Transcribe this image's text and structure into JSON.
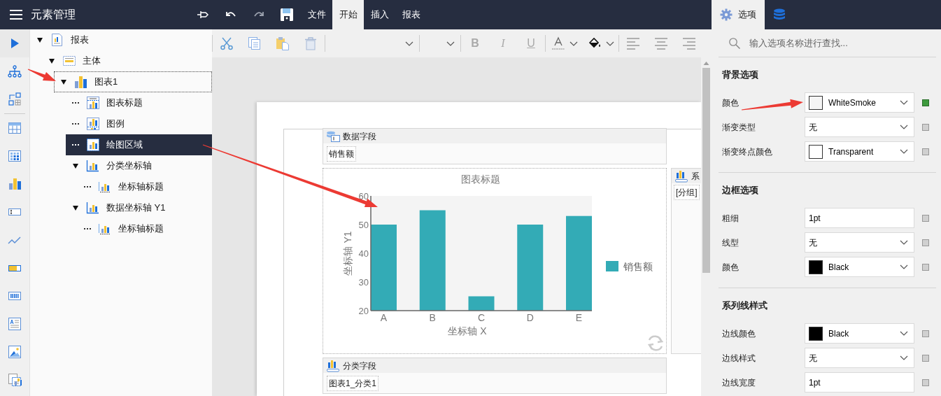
{
  "header": {
    "title": "元素管理",
    "menu": [
      {
        "label": "文件",
        "selected": false
      },
      {
        "label": "开始",
        "selected": true
      },
      {
        "label": "插入",
        "selected": false
      },
      {
        "label": "报表",
        "selected": false
      }
    ]
  },
  "side_tabs": [
    {
      "kind": "options",
      "label": "选项",
      "selected": true
    },
    {
      "kind": "data",
      "selected": false
    }
  ],
  "rail": [
    {
      "kind": "play"
    },
    {
      "kind": "tree"
    },
    {
      "kind": "add"
    },
    {
      "kind": "sep"
    },
    {
      "kind": "table"
    },
    {
      "kind": "matrix"
    },
    {
      "kind": "chart"
    },
    {
      "kind": "textbox"
    },
    {
      "kind": "sparkline"
    },
    {
      "kind": "bar"
    },
    {
      "kind": "barcode"
    },
    {
      "kind": "richtext"
    },
    {
      "kind": "image"
    },
    {
      "kind": "subreport"
    }
  ],
  "tree": [
    {
      "label": "报表",
      "kind": "report",
      "expanded": true,
      "selected": false,
      "focused": false,
      "children": [
        {
          "label": "主体",
          "kind": "band",
          "expanded": true,
          "selected": false,
          "focused": false,
          "children": [
            {
              "label": "图表1",
              "kind": "chart",
              "expanded": true,
              "selected": false,
              "focused": true,
              "children": [
                {
                  "label": "图表标题",
                  "kind": "chart-title",
                  "selected": false,
                  "focused": false
                },
                {
                  "label": "图例",
                  "kind": "legend",
                  "selected": false,
                  "focused": false
                },
                {
                  "label": "绘图区域",
                  "kind": "plot-area",
                  "selected": true,
                  "focused": false
                },
                {
                  "label": "分类坐标轴",
                  "kind": "axis",
                  "expanded": true,
                  "selected": false,
                  "focused": false,
                  "children": [
                    {
                      "label": "坐标轴标题",
                      "kind": "axis-title",
                      "selected": false,
                      "focused": false
                    }
                  ]
                },
                {
                  "label": "数据坐标轴 Y1",
                  "kind": "axis",
                  "expanded": true,
                  "selected": false,
                  "focused": false,
                  "children": [
                    {
                      "label": "坐标轴标题",
                      "kind": "axis-title",
                      "selected": false,
                      "focused": false
                    }
                  ]
                }
              ]
            }
          ]
        }
      ]
    }
  ],
  "toolbar": [
    {
      "kind": "sep"
    },
    {
      "kind": "cut"
    },
    {
      "kind": "copy"
    },
    {
      "kind": "paste"
    },
    {
      "kind": "delete"
    },
    {
      "kind": "sep"
    },
    {
      "kind": "font-family"
    },
    {
      "kind": "sep"
    },
    {
      "kind": "font-size"
    },
    {
      "kind": "sep"
    },
    {
      "kind": "bold",
      "label": "B"
    },
    {
      "kind": "italic",
      "label": "I"
    },
    {
      "kind": "underline",
      "label": "U"
    },
    {
      "kind": "sep"
    },
    {
      "kind": "font-color"
    },
    {
      "kind": "fill-color"
    },
    {
      "kind": "sep"
    },
    {
      "kind": "align-left"
    },
    {
      "kind": "align-center"
    },
    {
      "kind": "align-right"
    }
  ],
  "designer": {
    "data_field": {
      "title": "数据字段",
      "items": [
        "销售额"
      ]
    },
    "chart": {
      "chart_data": {
        "type": "bar",
        "title": "图表标题",
        "xlabel": "坐标轴 X",
        "ylabel": "坐标轴 Y1",
        "categories": [
          "A",
          "B",
          "C",
          "D",
          "E"
        ],
        "series": [
          {
            "name": "销售额",
            "color": "#33abb6",
            "values": [
              50,
              55,
              25,
              50,
              53
            ]
          }
        ],
        "ylim": [
          20,
          60
        ],
        "yticks": [
          20,
          30,
          40,
          50,
          60
        ]
      }
    },
    "series_field": {
      "title": "系",
      "items": [
        "[分组]"
      ]
    },
    "category_field": {
      "title": "分类字段",
      "items": [
        "图表1_分类1"
      ]
    }
  },
  "options": {
    "search": {
      "placeholder": "输入选项名称进行查找..."
    },
    "sections": [
      {
        "title": "背景选项",
        "rows": [
          {
            "label": "颜色",
            "kind": "color",
            "value": "WhiteSmoke",
            "color": "#f5f5f5",
            "modified": true
          },
          {
            "label": "渐变类型",
            "kind": "select",
            "value": "无",
            "modified": false
          },
          {
            "label": "渐变终点颜色",
            "kind": "color",
            "value": "Transparent",
            "color": "#ffffff",
            "modified": false
          }
        ]
      },
      {
        "title": "边框选项",
        "rows": [
          {
            "label": "粗细",
            "kind": "input",
            "value": "1pt",
            "modified": false
          },
          {
            "label": "线型",
            "kind": "select",
            "value": "无",
            "modified": false
          },
          {
            "label": "颜色",
            "kind": "color",
            "value": "Black",
            "color": "#000000",
            "modified": false
          }
        ]
      },
      {
        "title": "系列线样式",
        "rows": [
          {
            "label": "边线颜色",
            "kind": "color",
            "value": "Black",
            "color": "#000000",
            "modified": false
          },
          {
            "label": "边线样式",
            "kind": "select",
            "value": "无",
            "modified": false
          },
          {
            "label": "边线宽度",
            "kind": "input",
            "value": "1pt",
            "modified": false
          }
        ]
      }
    ]
  }
}
